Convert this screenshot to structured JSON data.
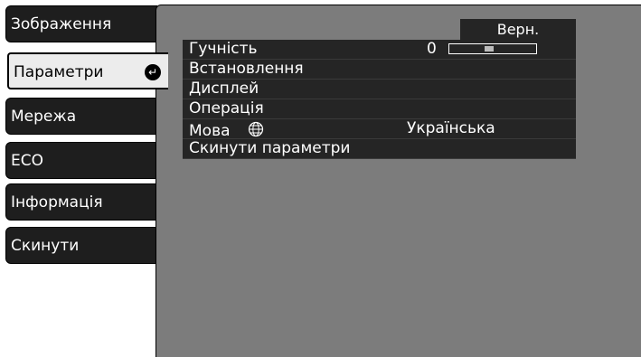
{
  "sidebar": {
    "tabs": [
      {
        "label": "Зображення"
      },
      {
        "label": "Параметри",
        "selected": true
      },
      {
        "label": "Мережа"
      },
      {
        "label": "ECO"
      },
      {
        "label": "Інформація"
      },
      {
        "label": "Скинути"
      }
    ]
  },
  "panel": {
    "top_label": "Верн.",
    "items": [
      {
        "label": "Гучність",
        "value": "0"
      },
      {
        "label": "Встановлення"
      },
      {
        "label": "Дисплей"
      },
      {
        "label": "Операція"
      },
      {
        "label": "Мова",
        "value": "Українська"
      },
      {
        "label": "Скинути параметри"
      }
    ],
    "volume_level": 0.45
  },
  "icons": {
    "enter": "enter-icon",
    "language": "globe-icon"
  },
  "colors": {
    "panel_bg": "#7c7c7c",
    "row_bg": "#252525",
    "tab_bg": "#1e1e1e",
    "tab_selected_bg": "#ececec"
  }
}
